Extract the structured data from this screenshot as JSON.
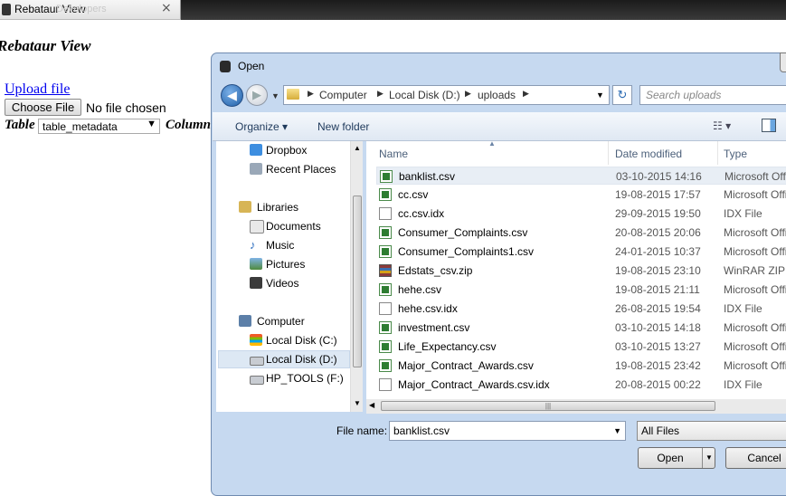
{
  "browser": {
    "tab_title": "Rebataur View",
    "tab_ghost_text": "Developers",
    "close_glyph": "×"
  },
  "page": {
    "heading": "Rebataur View",
    "upload_link": "Upload file",
    "choose_file": "Choose File",
    "no_file": "No file chosen",
    "table_label": "Table",
    "table_selected": "table_metadata",
    "column_label": "Column"
  },
  "dialog": {
    "title": "Open",
    "breadcrumb": [
      "Computer",
      "Local Disk (D:)",
      "uploads"
    ],
    "search_placeholder": "Search uploads",
    "toolbar": {
      "organize": "Organize ▾",
      "new_folder": "New folder"
    },
    "nav": [
      {
        "label": "Dropbox",
        "icon": "dropbox-icon"
      },
      {
        "label": "Recent Places",
        "icon": "recent-places-icon"
      },
      {
        "label": "Libraries",
        "icon": "libraries-icon"
      },
      {
        "label": "Documents",
        "icon": "documents-icon"
      },
      {
        "label": "Music",
        "icon": "music-icon"
      },
      {
        "label": "Pictures",
        "icon": "pictures-icon"
      },
      {
        "label": "Videos",
        "icon": "videos-icon"
      },
      {
        "label": "Computer",
        "icon": "computer-icon"
      },
      {
        "label": "Local Disk (C:)",
        "icon": "drive-icon"
      },
      {
        "label": "Local Disk (D:)",
        "icon": "drive-icon",
        "selected": true
      },
      {
        "label": "HP_TOOLS (F:)",
        "icon": "drive-icon"
      }
    ],
    "columns": {
      "name": "Name",
      "date": "Date modified",
      "type": "Type"
    },
    "files": [
      {
        "name": "banklist.csv",
        "date": "03-10-2015 14:16",
        "type": "Microsoft Office",
        "icon": "excel-csv-icon",
        "selected": true
      },
      {
        "name": "cc.csv",
        "date": "19-08-2015 17:57",
        "type": "Microsoft Office",
        "icon": "excel-csv-icon"
      },
      {
        "name": "cc.csv.idx",
        "date": "29-09-2015 19:50",
        "type": "IDX File",
        "icon": "blank-file-icon"
      },
      {
        "name": "Consumer_Complaints.csv",
        "date": "20-08-2015 20:06",
        "type": "Microsoft Office",
        "icon": "excel-csv-icon"
      },
      {
        "name": "Consumer_Complaints1.csv",
        "date": "24-01-2015 10:37",
        "type": "Microsoft Office",
        "icon": "excel-csv-icon"
      },
      {
        "name": "Edstats_csv.zip",
        "date": "19-08-2015 23:10",
        "type": "WinRAR ZIP a",
        "icon": "winrar-zip-icon"
      },
      {
        "name": "hehe.csv",
        "date": "19-08-2015 21:11",
        "type": "Microsoft Office",
        "icon": "excel-csv-icon"
      },
      {
        "name": "hehe.csv.idx",
        "date": "26-08-2015 19:54",
        "type": "IDX File",
        "icon": "blank-file-icon"
      },
      {
        "name": "investment.csv",
        "date": "03-10-2015 14:18",
        "type": "Microsoft Office",
        "icon": "excel-csv-icon"
      },
      {
        "name": "Life_Expectancy.csv",
        "date": "03-10-2015 13:27",
        "type": "Microsoft Office",
        "icon": "excel-csv-icon"
      },
      {
        "name": "Major_Contract_Awards.csv",
        "date": "19-08-2015 23:42",
        "type": "Microsoft Office",
        "icon": "excel-csv-icon"
      },
      {
        "name": "Major_Contract_Awards.csv.idx",
        "date": "20-08-2015 00:22",
        "type": "IDX File",
        "icon": "blank-file-icon"
      }
    ],
    "file_name_label": "File name:",
    "file_name_value": "banklist.csv",
    "filter": "All Files",
    "open_label": "Open",
    "cancel_label": "Cancel"
  }
}
